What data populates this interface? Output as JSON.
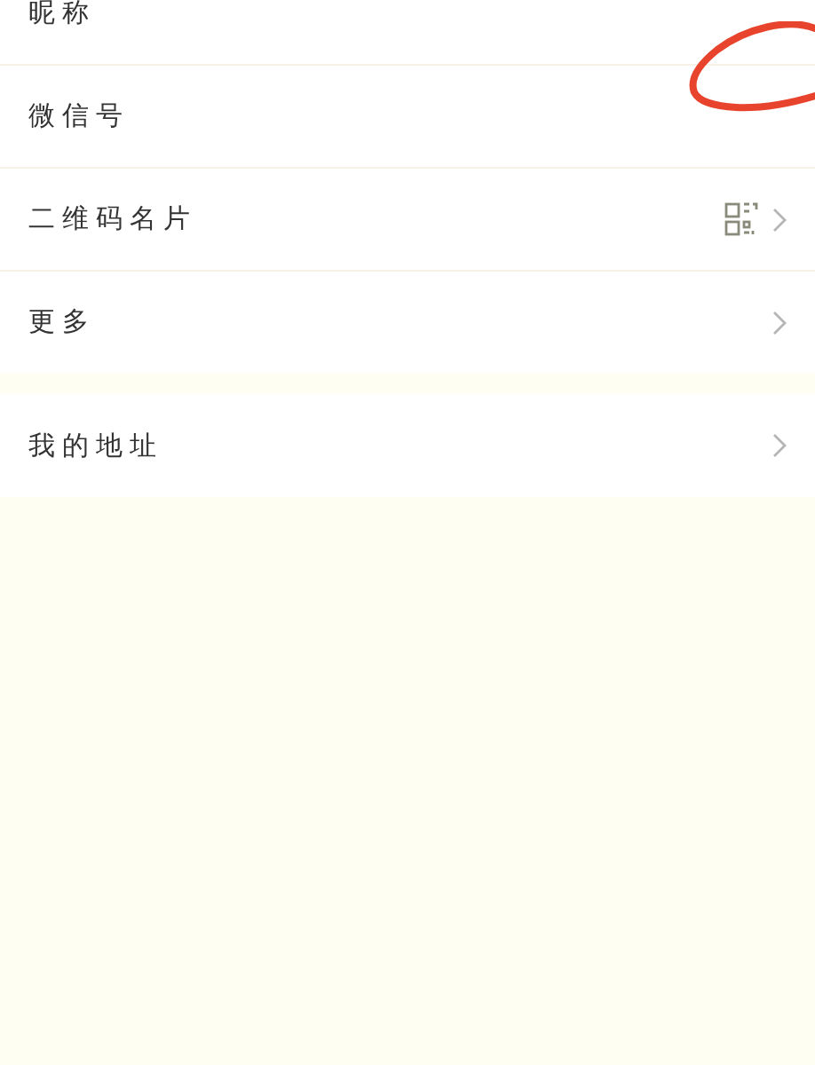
{
  "sections": [
    {
      "items": [
        {
          "label": "昵称",
          "qr_code": false,
          "arrow": false
        },
        {
          "label": "微信号",
          "qr_code": false,
          "arrow": false
        },
        {
          "label": "二维码名片",
          "qr_code": true,
          "arrow": true
        },
        {
          "label": "更多",
          "qr_code": false,
          "arrow": true
        }
      ]
    },
    {
      "items": [
        {
          "label": "我的地址",
          "qr_code": false,
          "arrow": true
        }
      ]
    }
  ]
}
